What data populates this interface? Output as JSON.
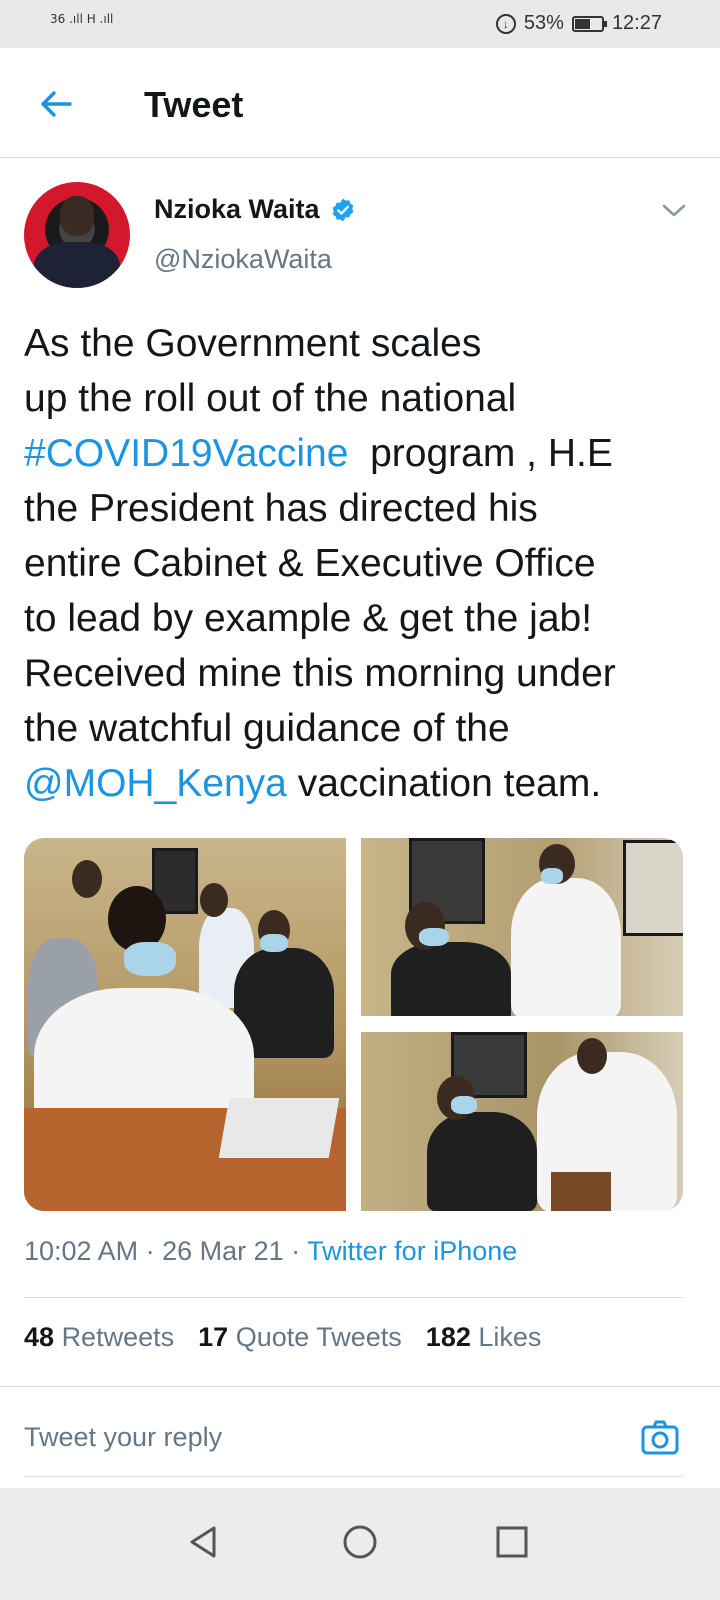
{
  "status_bar": {
    "network_left": "36 .ıll H .ıll",
    "battery_percent": "53%",
    "time": "12:27",
    "battery_level": 0.53
  },
  "header": {
    "title": "Tweet",
    "back_icon": "arrow-left-icon"
  },
  "author": {
    "name": "Nzioka Waita",
    "handle": "@NziokaWaita",
    "verified_icon": "verified-badge-icon",
    "avatar_bg": "#d3182c"
  },
  "tweet": {
    "text_part1": "As the Government scales\nup the roll out of the national\n",
    "hashtag": "#COVID19Vaccine",
    "text_part2": "  program , H.E\nthe President has directed his\nentire Cabinet & Executive Office\nto lead by example & get the jab!\nReceived mine this morning under\nthe watchful guidance of the\n",
    "mention": "@MOH_Kenya",
    "text_part3": " vaccination team."
  },
  "meta": {
    "time": "10:02 AM",
    "sep1": " · ",
    "date": "26 Mar 21",
    "sep2": " · ",
    "source": "Twitter for iPhone"
  },
  "stats": {
    "retweets_count": "48",
    "retweets_label": "Retweets",
    "quotes_count": "17",
    "quotes_label": "Quote Tweets",
    "likes_count": "182",
    "likes_label": "Likes"
  },
  "reply": {
    "placeholder": "Tweet your reply",
    "camera_icon": "camera-icon"
  },
  "colors": {
    "link": "#1b95e0",
    "text": "#14171a",
    "muted": "#657786"
  }
}
